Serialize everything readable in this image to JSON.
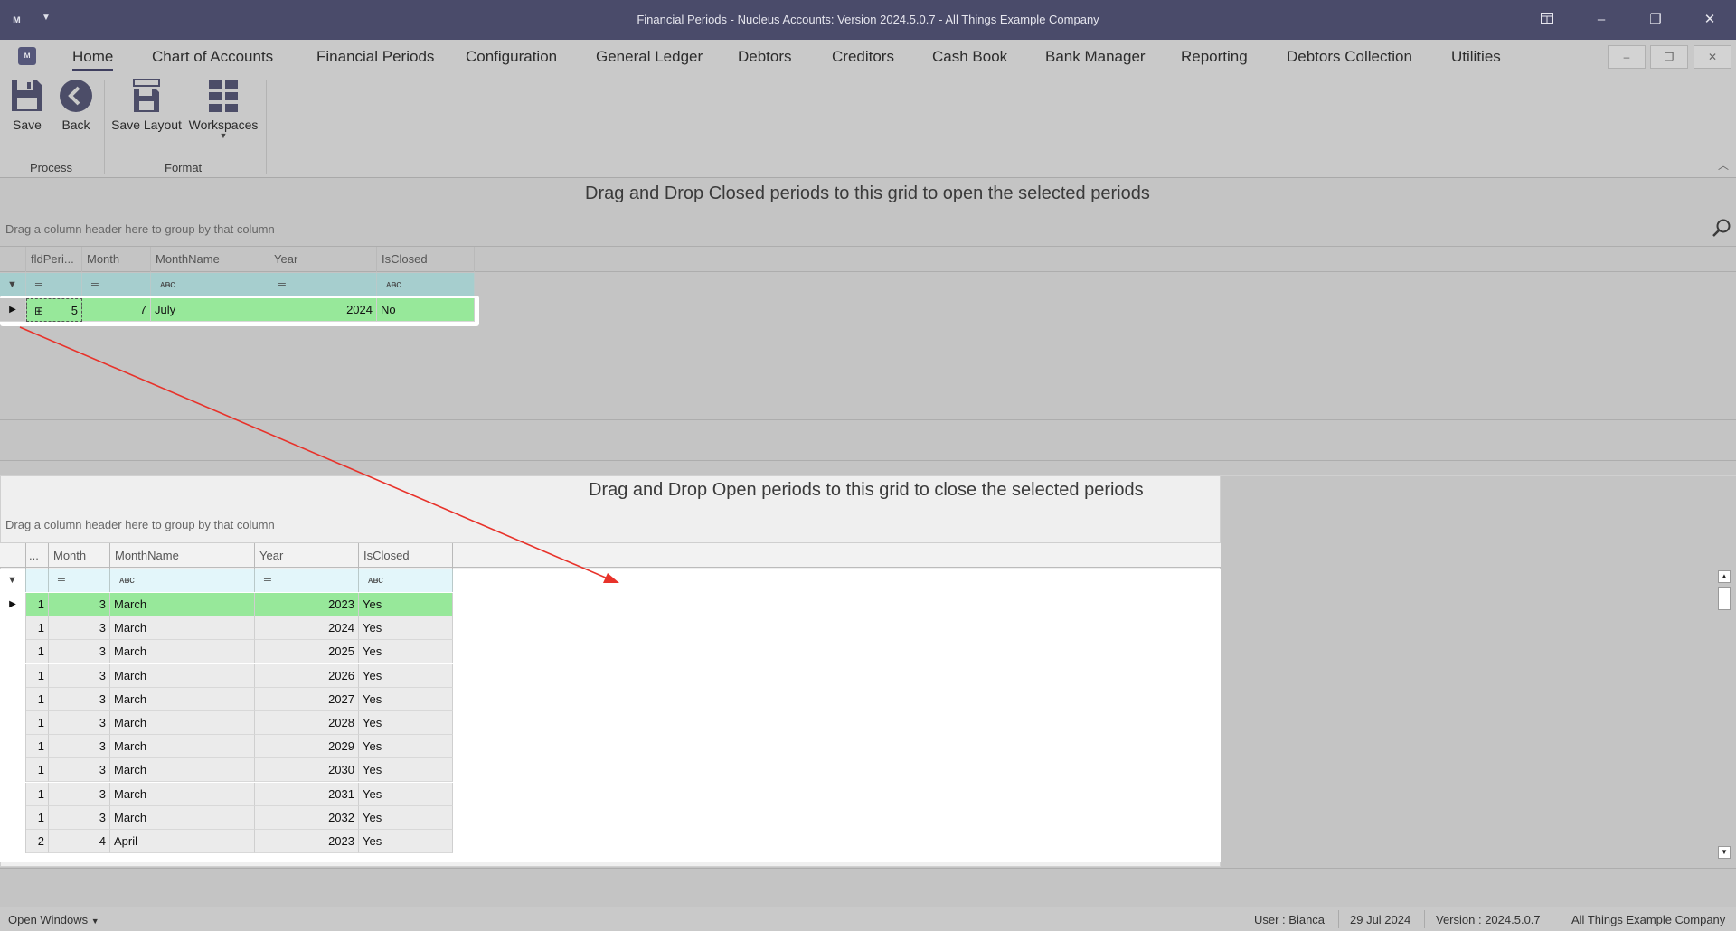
{
  "window": {
    "title": "Financial Periods - Nucleus Accounts: Version 2024.5.0.7 - All Things Example Company",
    "app_icon": "ᴍ",
    "quick_access_icon": "chevron-down-icon"
  },
  "tabs": [
    "Home",
    "Chart of Accounts",
    "Financial Periods",
    "Configuration",
    "General Ledger",
    "Debtors",
    "Creditors",
    "Cash Book",
    "Bank Manager",
    "Reporting",
    "Debtors Collection",
    "Utilities"
  ],
  "ribbon": {
    "save": "Save",
    "back": "Back",
    "save_layout": "Save Layout",
    "workspaces": "Workspaces",
    "group_process": "Process",
    "group_format": "Format"
  },
  "closed_grid": {
    "title": "Drag and Drop Closed periods to this grid to open the selected periods",
    "group_hint": "Drag a column header here to group by that column",
    "columns": [
      "fldPeri...",
      "Month",
      "MonthName",
      "Year",
      "IsClosed"
    ],
    "rows": [
      {
        "id": "5",
        "month": "7",
        "month_name": "July",
        "year": "2024",
        "is_closed": "No"
      }
    ]
  },
  "open_grid": {
    "title": "Drag and Drop Open periods to this grid to close the selected periods",
    "group_hint": "Drag a column header here to group by that column",
    "columns": [
      "...",
      "Month",
      "MonthName",
      "Year",
      "IsClosed"
    ],
    "rows": [
      {
        "id": "1",
        "month": "3",
        "month_name": "March",
        "year": "2023",
        "is_closed": "Yes"
      },
      {
        "id": "1",
        "month": "3",
        "month_name": "March",
        "year": "2024",
        "is_closed": "Yes"
      },
      {
        "id": "1",
        "month": "3",
        "month_name": "March",
        "year": "2025",
        "is_closed": "Yes"
      },
      {
        "id": "1",
        "month": "3",
        "month_name": "March",
        "year": "2026",
        "is_closed": "Yes"
      },
      {
        "id": "1",
        "month": "3",
        "month_name": "March",
        "year": "2027",
        "is_closed": "Yes"
      },
      {
        "id": "1",
        "month": "3",
        "month_name": "March",
        "year": "2028",
        "is_closed": "Yes"
      },
      {
        "id": "1",
        "month": "3",
        "month_name": "March",
        "year": "2029",
        "is_closed": "Yes"
      },
      {
        "id": "1",
        "month": "3",
        "month_name": "March",
        "year": "2030",
        "is_closed": "Yes"
      },
      {
        "id": "1",
        "month": "3",
        "month_name": "March",
        "year": "2031",
        "is_closed": "Yes"
      },
      {
        "id": "1",
        "month": "3",
        "month_name": "March",
        "year": "2032",
        "is_closed": "Yes"
      },
      {
        "id": "2",
        "month": "4",
        "month_name": "April",
        "year": "2023",
        "is_closed": "Yes"
      }
    ]
  },
  "statusbar": {
    "open_windows": "Open Windows",
    "user": "User : Bianca",
    "date": "29 Jul 2024",
    "version": "Version : 2024.5.0.7",
    "company": "All Things Example Company"
  },
  "colors": {
    "titlebar": "#4a4b6a",
    "selected_row": "#97e89a",
    "highlight_frame": "#ffffff",
    "annotation_arrow": "#e8322a"
  }
}
